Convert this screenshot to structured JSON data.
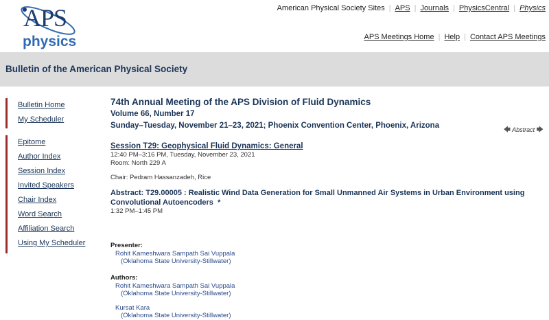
{
  "logo": {
    "line1": "APS",
    "line2": "physics"
  },
  "top_links": {
    "sites": "American Physical Society Sites",
    "aps": "APS",
    "journals": "Journals",
    "physicscentral": "PhysicsCentral",
    "physics": "Physics"
  },
  "meeting_links": {
    "home": "APS Meetings Home",
    "help": "Help",
    "contact": "Contact APS Meetings"
  },
  "band_title": "Bulletin of the American Physical Society",
  "sidebar": {
    "group1": [
      "Bulletin Home",
      "My Scheduler"
    ],
    "group2": [
      "Epitome",
      "Author Index",
      "Session Index",
      "Invited Speakers",
      "Chair Index",
      "Word Search",
      "Affiliation Search",
      "Using My Scheduler"
    ]
  },
  "main": {
    "meeting": "74th Annual Meeting of the APS Division of Fluid Dynamics",
    "volume": "Volume 66, Number 17",
    "dates": "Sunday–Tuesday, November 21–23, 2021; Phoenix Convention Center, Phoenix, Arizona",
    "session_title": "Session T29: Geophysical Fluid Dynamics: General",
    "session_time": "12:40 PM–3:16 PM, Tuesday, November 23, 2021",
    "room": "Room: North 229 A",
    "chair": "Chair: Pedram Hassanzadeh, Rice",
    "abstract_title": "Abstract: T29.00005 : Realistic Wind Data Generation for Small Unmanned Air Systems in Urban Environment using Convolutional Autoencoders",
    "abstract_star": "*",
    "abstract_time": "1:32 PM–1:45 PM",
    "nav_left": "🡄",
    "nav_label": "Abstract",
    "nav_right": "🡆",
    "presenter_label": "Presenter:",
    "presenter_name": "Rohit Kameshwara Sampath Sai Vuppala",
    "presenter_inst": "(Oklahoma State University-Stillwater)",
    "authors_label": "Authors:",
    "author1_name": "Rohit Kameshwara Sampath Sai Vuppala",
    "author1_inst": "(Oklahoma State University-Stillwater)",
    "author2_name": "Kursat Kara",
    "author2_inst": "(Oklahoma State University-Stillwater)"
  }
}
